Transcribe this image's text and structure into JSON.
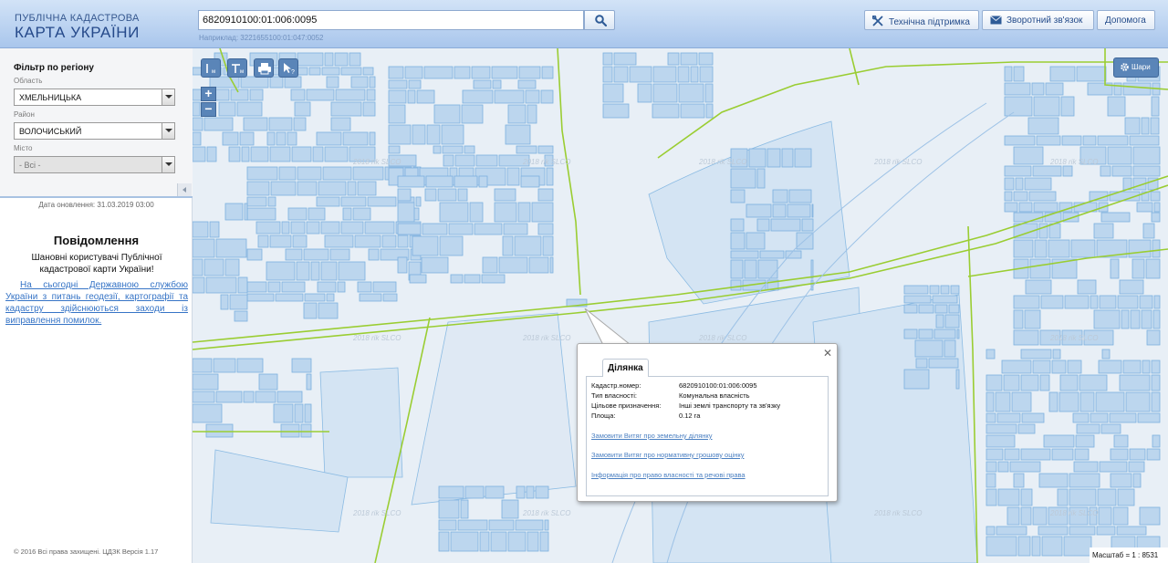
{
  "header": {
    "logo_top": "ПУБЛІЧНА КАДАСТРОВА",
    "logo_bottom": "КАРТА УКРАЇНИ",
    "search_value": "6820910100:01:006:0095",
    "search_example": "Наприклад: 3221655100:01:047:0052",
    "support_label": "Технічна підтримка",
    "feedback_label": "Зворотний зв'язок",
    "help_label": "Допомога"
  },
  "sidebar": {
    "filter_title": "Фільтр по регіону",
    "oblast_label": "Область",
    "oblast_value": "ХМЕЛЬНИЦЬКА",
    "rayon_label": "Район",
    "rayon_value": "ВОЛОЧИСЬКИЙ",
    "city_label": "Місто",
    "city_value": "- Всі -",
    "update_date": "Дата оновлення: 31.03.2019 03:00",
    "notice_title": "Повідомлення",
    "notice_greeting": "Шановні користувачі Публічної кадастрової карти України!",
    "notice_link": "На сьогодні Державною службою України з питань геодезії, картографії та кадастру здійснюються заходи із виправлення помилок.",
    "copyright": "© 2016 Всі права захищені. ЦДЗК Версія 1.17"
  },
  "map": {
    "watermark": "2018 rik SLCO",
    "layers_label": "Шари",
    "scale": "Масштаб = 1 : 8531",
    "colors": {
      "parcel_fill": "#bcd6ee",
      "parcel_stroke": "#7cb0de",
      "boundary": "#9acd32",
      "background": "#e8eff6"
    }
  },
  "popup": {
    "tab_label": "Ділянка",
    "rows": [
      {
        "key": "Кадастр.номер:",
        "value": "6820910100:01:006:0095"
      },
      {
        "key": "Тип власності:",
        "value": "Комунальна власність"
      },
      {
        "key": "Цільове призначення:",
        "value": "Інші землі транспорту та зв'язку"
      },
      {
        "key": "Площа:",
        "value": "0.12 га"
      }
    ],
    "links": [
      "Замовити Витяг про земельну ділянку",
      "Замовити Витяг про нормативну грошову оцінку",
      "Інформація про право власності та речові права"
    ]
  }
}
